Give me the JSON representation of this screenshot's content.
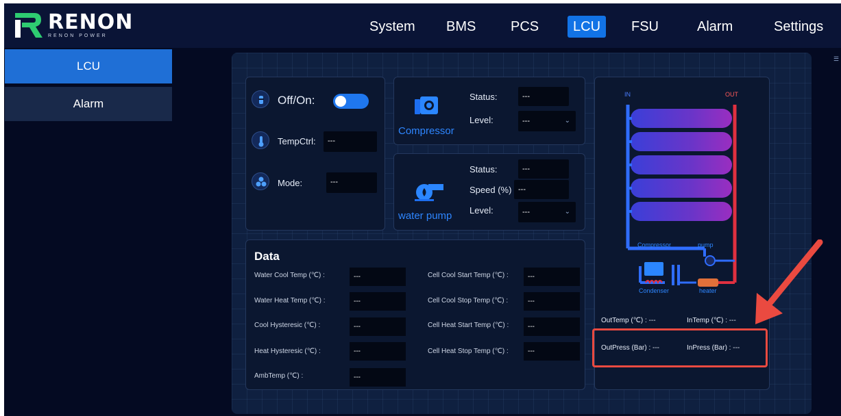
{
  "brand": {
    "name": "RENON",
    "tagline": "RENON POWER"
  },
  "nav": [
    {
      "label": "System",
      "active": false
    },
    {
      "label": "BMS",
      "active": false
    },
    {
      "label": "PCS",
      "active": false
    },
    {
      "label": "LCU",
      "active": true
    },
    {
      "label": "FSU",
      "active": false
    },
    {
      "label": "Alarm",
      "active": false
    },
    {
      "label": "Settings",
      "active": false
    }
  ],
  "sidebar": [
    {
      "label": "LCU",
      "active": true
    },
    {
      "label": "Alarm",
      "active": false
    }
  ],
  "control": {
    "power_label": "Off/On:",
    "power_on": true,
    "tempctrl_label": "TempCtrl:",
    "tempctrl_value": "---",
    "mode_label": "Mode:",
    "mode_value": "---"
  },
  "compressor": {
    "title": "Compressor",
    "status_label": "Status:",
    "status_value": "---",
    "level_label": "Level:",
    "level_value": "---"
  },
  "water_pump": {
    "title": "water pump",
    "status_label": "Status:",
    "status_value": "---",
    "speed_label": "Speed (%)",
    "speed_value": "---",
    "level_label": "Level:",
    "level_value": "---"
  },
  "data": {
    "title": "Data",
    "left": [
      {
        "label": "Water Cool Temp (℃) :",
        "value": "---"
      },
      {
        "label": "Water Heat Temp (℃) :",
        "value": "---"
      },
      {
        "label": "Cool Hysteresic (℃) :",
        "value": "---"
      },
      {
        "label": "Heat Hysteresic (℃) :",
        "value": "---"
      },
      {
        "label": "AmbTemp (℃) :",
        "value": "---"
      }
    ],
    "right": [
      {
        "label": "Cell Cool Start Temp (℃) :",
        "value": "---"
      },
      {
        "label": "Cell Cool Stop Temp (℃) :",
        "value": "---"
      },
      {
        "label": "Cell Heat Start Temp (℃) :",
        "value": "---"
      },
      {
        "label": "Cell Heat Stop Temp (℃) :",
        "value": "---"
      }
    ]
  },
  "diagram": {
    "in_label": "IN",
    "out_label": "OUT",
    "compressor_label": "Compressor",
    "pump_label": "pump",
    "condenser_label": "Condenser",
    "heater_label": "heater"
  },
  "readings": {
    "out_temp": "OutTemp (℃) : ---",
    "in_temp": "InTemp (℃) :  ---",
    "out_press": "OutPress (Bar) : ---",
    "in_press": "InPress (Bar) :  ---"
  },
  "colors": {
    "accent": "#1273e6",
    "annotation": "#ea4a40",
    "cold_pipe": "#2f6dff",
    "hot_pipe": "#e03040"
  }
}
